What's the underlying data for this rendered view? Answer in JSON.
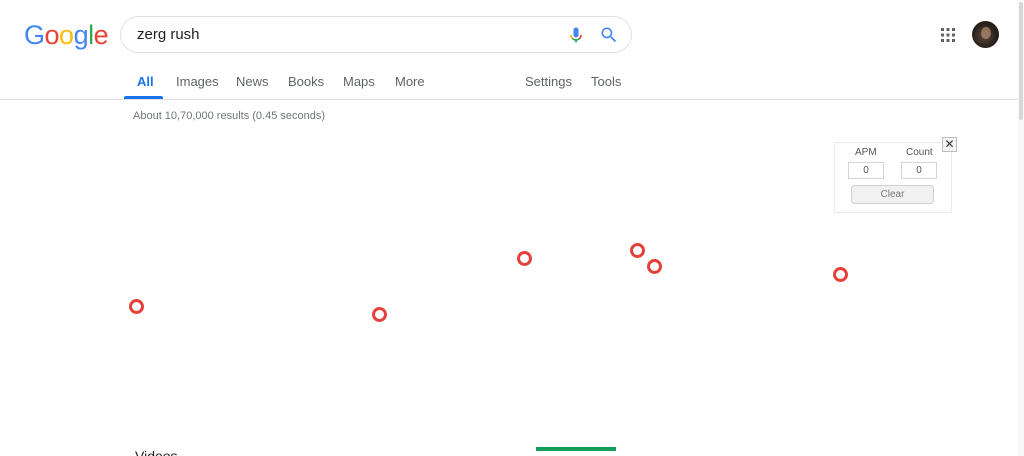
{
  "logo": {
    "letters": [
      {
        "char": "G",
        "color": "#4285f4"
      },
      {
        "char": "o",
        "color": "#ea4335"
      },
      {
        "char": "o",
        "color": "#fbbc05"
      },
      {
        "char": "g",
        "color": "#4285f4"
      },
      {
        "char": "l",
        "color": "#34a853"
      },
      {
        "char": "e",
        "color": "#ea4335"
      }
    ]
  },
  "search": {
    "query": "zerg rush",
    "mic_icon": "microphone-icon",
    "search_icon": "magnifier-icon"
  },
  "header": {
    "apps_icon": "grid-apps-icon",
    "avatar": "profile-avatar"
  },
  "tabs": [
    "All",
    "Images",
    "News",
    "Books",
    "Maps",
    "More",
    "Settings",
    "Tools"
  ],
  "active_tab": "All",
  "results": {
    "stats": "About 10,70,000 results (0.45 seconds)"
  },
  "zerg_game": {
    "zerglings": 6,
    "zergling_color": "#e5413a",
    "panel": {
      "apm_label": "APM",
      "apm_value": "0",
      "count_label": "Count",
      "count_value": "0",
      "clear_label": "Clear",
      "close_label": "✕"
    }
  },
  "partial_heading": "Videos"
}
